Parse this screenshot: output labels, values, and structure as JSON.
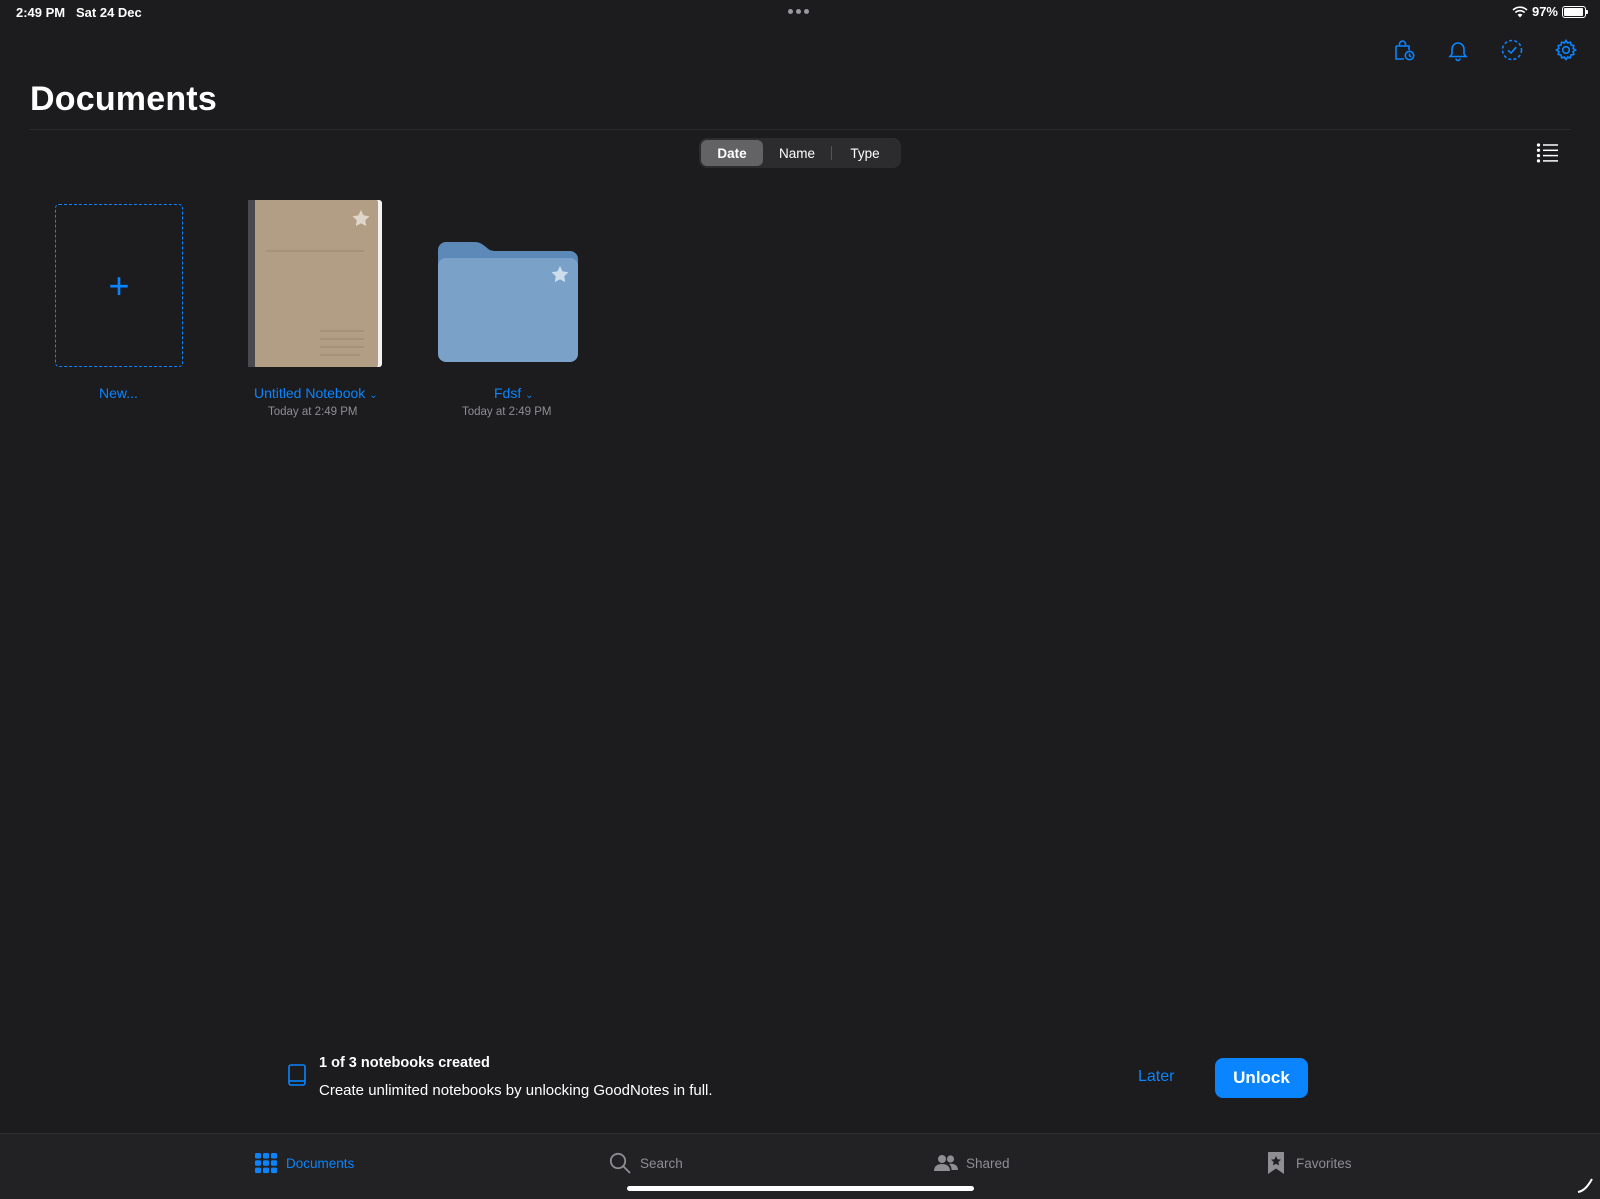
{
  "status_bar": {
    "time": "2:49 PM",
    "date": "Sat 24 Dec",
    "battery": "97%",
    "battery_level": 0.97
  },
  "toolbar": {
    "icons": [
      "store-icon",
      "bell-icon",
      "select-icon",
      "gear-icon"
    ]
  },
  "page": {
    "title": "Documents"
  },
  "sort": {
    "options": [
      "Date",
      "Name",
      "Type"
    ],
    "selected": "Date"
  },
  "documents": {
    "new_label": "New...",
    "items": [
      {
        "name": "Untitled Notebook",
        "date": "Today at 2:49 PM",
        "kind": "notebook"
      },
      {
        "name": "Fdsf",
        "date": "Today at 2:49 PM",
        "kind": "folder"
      }
    ]
  },
  "banner": {
    "title": "1 of 3 notebooks created",
    "text": "Create unlimited notebooks by unlocking GoodNotes in full.",
    "later_label": "Later",
    "unlock_label": "Unlock"
  },
  "tabs": [
    {
      "label": "Documents",
      "active": true
    },
    {
      "label": "Search",
      "active": false
    },
    {
      "label": "Shared",
      "active": false
    },
    {
      "label": "Favorites",
      "active": false
    }
  ],
  "colors": {
    "background": "#1c1c1e",
    "accent": "#0a84ff",
    "notebook_cover": "#b29e84",
    "folder": "#7aa2c9"
  }
}
